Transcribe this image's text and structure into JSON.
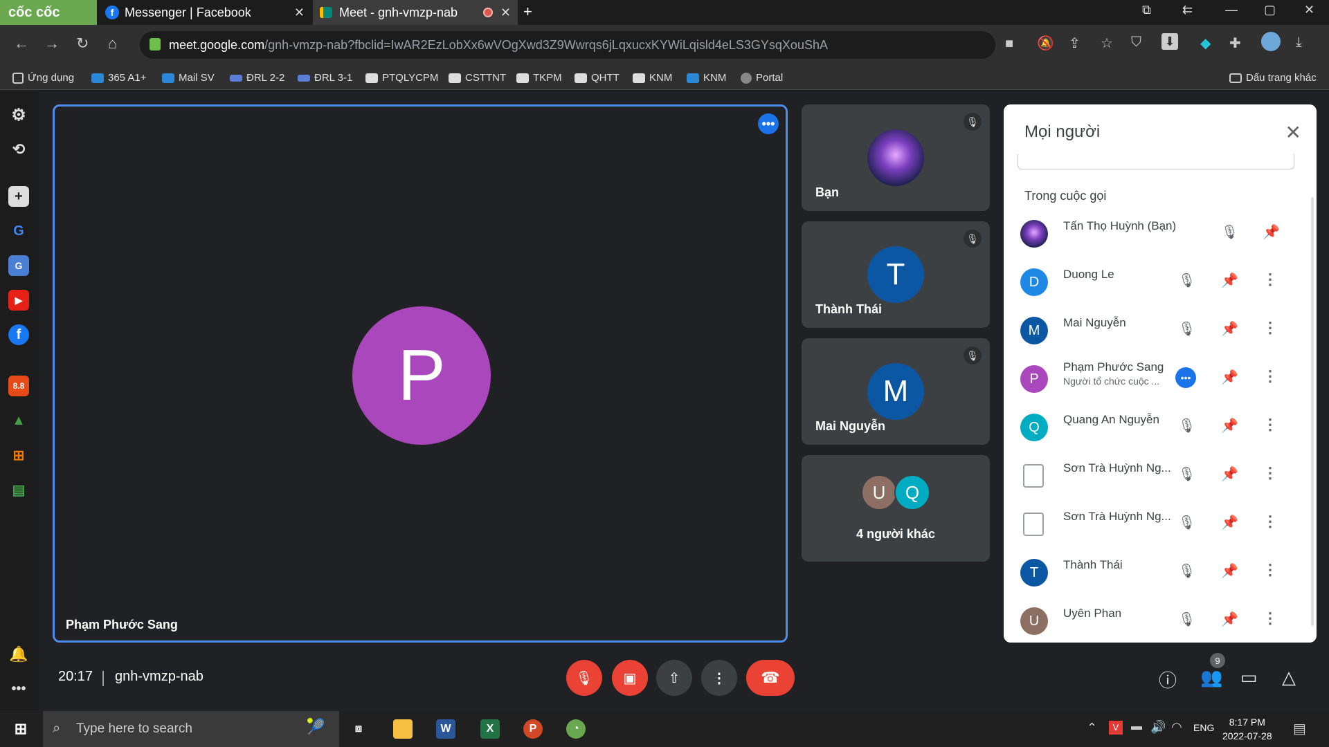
{
  "browser": {
    "brand": "cốc cốc",
    "tabs": [
      {
        "title": "Messenger | Facebook"
      },
      {
        "title": "Meet - gnh-vmzp-nab"
      }
    ],
    "url_host": "meet.google.com",
    "url_path": "/gnh-vmzp-nab?fbclid=IwAR2EzLobXx6wVOgXwd3Z9Wwrqs6jLqxucxKYWiLqisld4eLS3GYsqXouShA",
    "bookmarks": [
      "Ứng dụng",
      "365 A1+",
      "Mail SV",
      "ĐRL 2-2",
      "ĐRL 3-1",
      "PTQLYCPM",
      "CSTTNT",
      "TKPM",
      "QHTT",
      "KNM",
      "KNM",
      "Portal"
    ],
    "other_bookmarks": "Dấu trang khác"
  },
  "meet": {
    "main_participant": {
      "name": "Phạm Phước Sang",
      "initial": "P"
    },
    "tiles": [
      {
        "name": "Bạn",
        "initial": ""
      },
      {
        "name": "Thành Thái",
        "initial": "T"
      },
      {
        "name": "Mai Nguyễn",
        "initial": "M"
      },
      {
        "name": "4 người khác",
        "initials": [
          "U",
          "Q"
        ]
      }
    ],
    "people_panel": {
      "title": "Mọi người",
      "section": "Trong cuộc gọi",
      "participants": [
        {
          "name": "Tấn Thọ Huỳnh (Bạn)",
          "initial": "",
          "sub": ""
        },
        {
          "name": "Duong Le",
          "initial": "D",
          "sub": ""
        },
        {
          "name": "Mai Nguyễn",
          "initial": "M",
          "sub": ""
        },
        {
          "name": "Phạm Phước Sang",
          "initial": "P",
          "sub": "Người tổ chức cuộc ..."
        },
        {
          "name": "Quang An Nguyễn",
          "initial": "Q",
          "sub": ""
        },
        {
          "name": "Sơn Trà Huỳnh Ng...",
          "initial": "",
          "sub": ""
        },
        {
          "name": "Sơn Trà Huỳnh Ng...",
          "initial": "",
          "sub": ""
        },
        {
          "name": "Thành Thái",
          "initial": "T",
          "sub": ""
        },
        {
          "name": "Uyên Phan",
          "initial": "U",
          "sub": ""
        }
      ]
    },
    "clock": "20:17",
    "meeting_code": "gnh-vmzp-nab",
    "people_count": "9"
  },
  "taskbar": {
    "search_placeholder": "Type here to search",
    "language": "ENG",
    "time": "8:17 PM",
    "date": "2022-07-28"
  },
  "colors": {
    "accent_blue": "#1a73e8",
    "danger_red": "#ea4335",
    "purple_avatar": "#ab47bc",
    "teal_avatar": "#00acc1",
    "brown_avatar": "#8d6e63"
  }
}
